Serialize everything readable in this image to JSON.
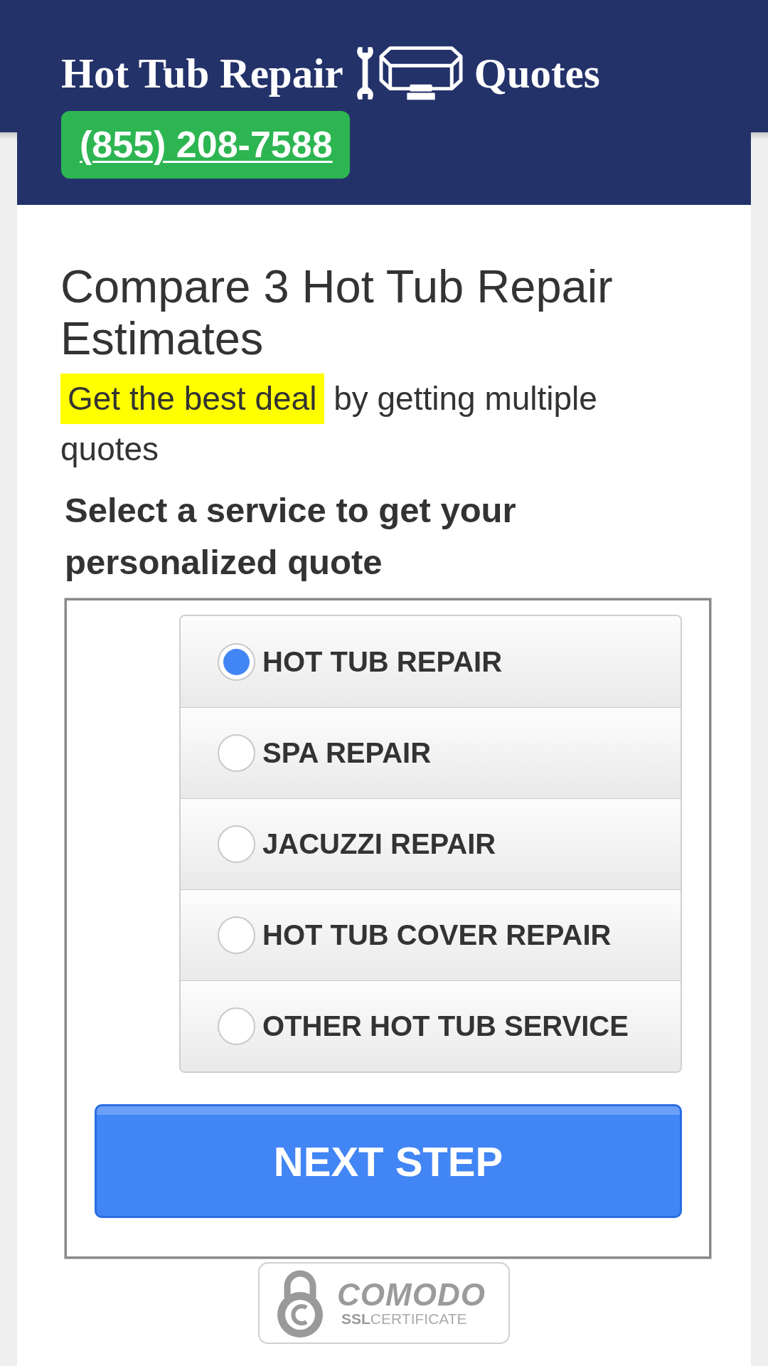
{
  "header": {
    "logo": {
      "text_before": "Hot Tub Repair",
      "text_after": "Quotes"
    },
    "phone": "(855) 208-7588"
  },
  "intro": {
    "title": "Compare 3 Hot Tub Repair Estimates",
    "tagline": {
      "highlight": "Get the best deal",
      "text": "by getting multiple quotes"
    }
  },
  "form": {
    "prompt": "Select a service to get your personalized quote",
    "options": [
      {
        "label": "HOT TUB REPAIR",
        "selected": true
      },
      {
        "label": "SPA REPAIR",
        "selected": false
      },
      {
        "label": "JACUZZI REPAIR",
        "selected": false
      },
      {
        "label": "HOT TUB COVER REPAIR",
        "selected": false
      },
      {
        "label": "OTHER HOT TUB SERVICE",
        "selected": false
      }
    ],
    "submit": "NEXT STEP"
  },
  "badge": {
    "brand": "COMODO",
    "caption": "**SSL**CERTIFICATE"
  }
}
